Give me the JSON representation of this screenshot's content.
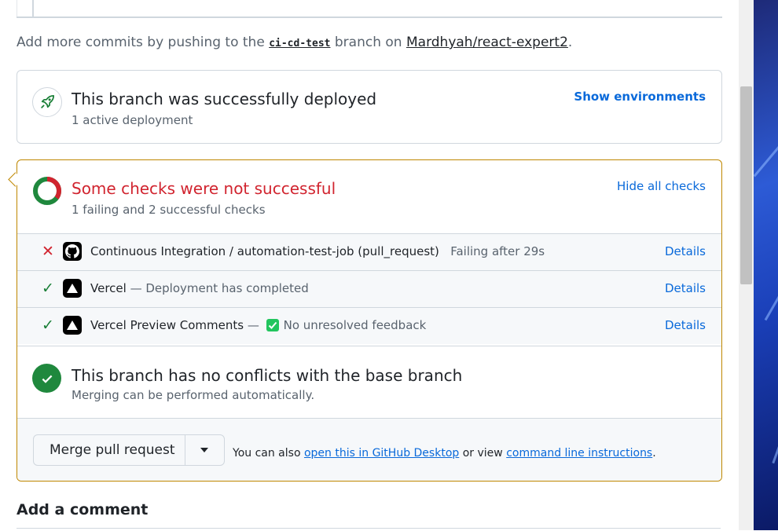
{
  "push_hint": {
    "prefix": "Add more commits by pushing to the",
    "branch": "ci-cd-test",
    "middle": "branch on",
    "repo": "Mardhyah/react-expert2",
    "suffix": "."
  },
  "deployment": {
    "icon": "rocket-icon",
    "title": "This branch was successfully deployed",
    "subtitle": "1 active deployment",
    "action": "Show environments"
  },
  "checks": {
    "status_color": "#d1242f",
    "title": "Some checks were not successful",
    "subtitle": "1 failing and 2 successful checks",
    "action": "Hide all checks",
    "items": [
      {
        "status": "failing",
        "status_icon": "x-icon",
        "app_icon": "github-icon",
        "name": "Continuous Integration / automation-test-job (pull_request)",
        "desc": "Failing after 29s",
        "details": "Details"
      },
      {
        "status": "success",
        "status_icon": "check-icon",
        "app_icon": "vercel-icon",
        "name": "Vercel",
        "desc": "— Deployment has completed",
        "details": "Details"
      },
      {
        "status": "success",
        "status_icon": "check-icon",
        "app_icon": "vercel-icon",
        "name": "Vercel Preview Comments",
        "dash": "—",
        "desc": "No unresolved feedback",
        "details": "Details"
      }
    ]
  },
  "conflicts": {
    "title": "This branch has no conflicts with the base branch",
    "subtitle": "Merging can be performed automatically."
  },
  "merge": {
    "button": "Merge pull request",
    "hint_prefix": "You can also",
    "link_desktop": "open this in GitHub Desktop",
    "hint_middle": "or view",
    "link_cli": "command line instructions",
    "hint_suffix": "."
  },
  "comment": {
    "heading": "Add a comment"
  },
  "colors": {
    "link": "#0969da",
    "success": "#1f883d",
    "danger": "#d1242f",
    "warning_border": "#bf8700"
  }
}
